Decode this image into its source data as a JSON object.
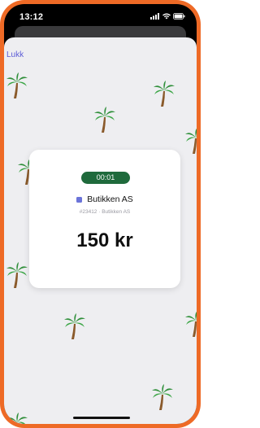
{
  "status_bar": {
    "time": "13:12"
  },
  "sheet": {
    "close_label": "Lukk"
  },
  "payment": {
    "timer": "00:01",
    "merchant_name": "Butikken AS",
    "reference": "#23412 · Butikken AS",
    "amount": "150 kr"
  },
  "colors": {
    "frame": "#ee6a26",
    "timer_bg": "#1f6a3c",
    "accent": "#5b5bd6"
  },
  "icons": [
    "signal-icon",
    "wifi-icon",
    "battery-icon",
    "palm-tree-icon",
    "merchant-icon"
  ]
}
